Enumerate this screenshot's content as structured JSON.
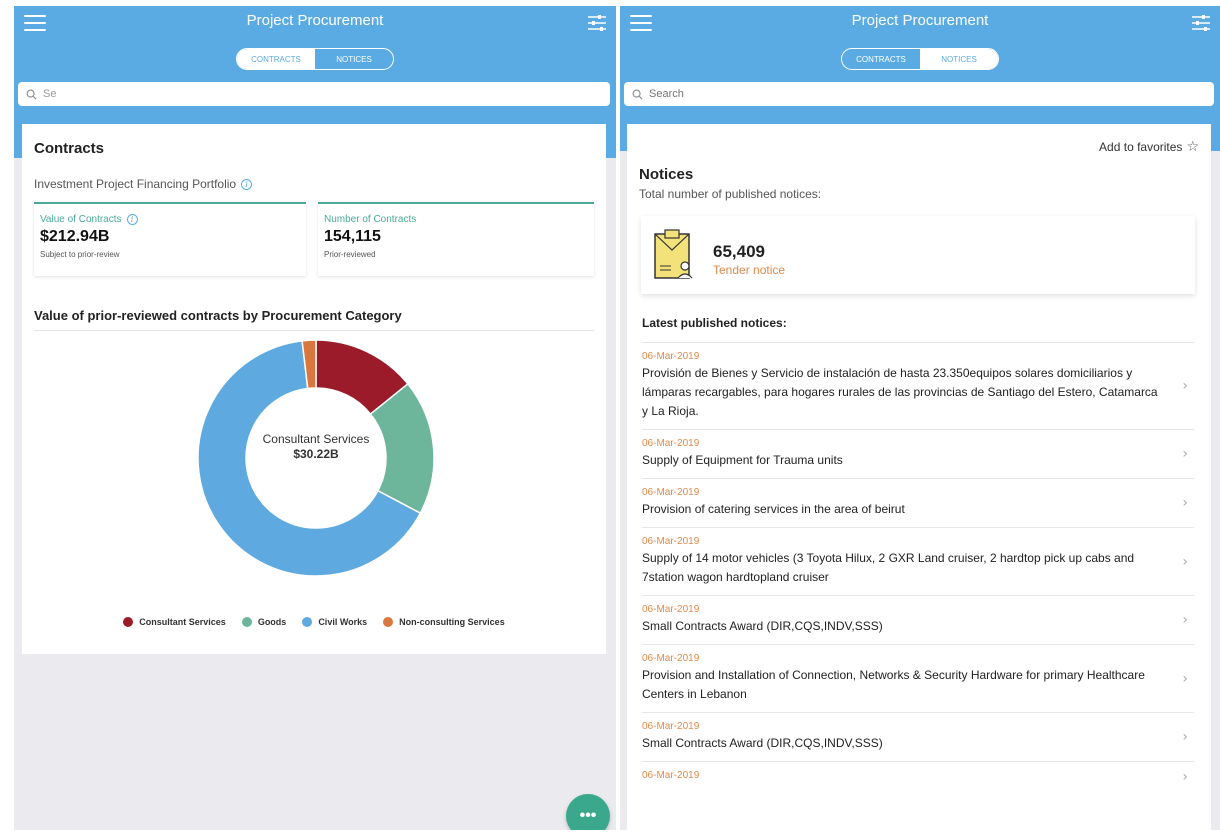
{
  "app_title": "Project Procurement",
  "tabs": {
    "contracts": "CONTRACTS",
    "notices": "NOTICES"
  },
  "left": {
    "search_placeholder": "Search",
    "search_value": "Se",
    "contracts_heading": "Contracts",
    "portfolio": "Investment Project Financing Portfolio",
    "kpis": [
      {
        "label": "Value of Contracts",
        "value": "$212.94B",
        "sub": "Subject to prior-review"
      },
      {
        "label": "Number of Contracts",
        "value": "154,115",
        "sub": "Prior-reviewed"
      }
    ],
    "chart_title": "Value of prior-reviewed contracts by Procurement Category",
    "center_label": {
      "name": "Consultant Services",
      "value": "$30.22B"
    },
    "fab_label": "•••"
  },
  "chart_data": {
    "type": "pie",
    "title": "Value of prior-reviewed contracts by Procurement Category",
    "categories": [
      "Consultant Services",
      "Goods",
      "Civil Works",
      "Non-consulting Services"
    ],
    "values": [
      30.22,
      39.5,
      139.2,
      4.0
    ],
    "colors": [
      "#9b1b2a",
      "#6db59b",
      "#5eaae0",
      "#d9773f"
    ],
    "donut": true,
    "legend": "bottom"
  },
  "right": {
    "search_placeholder": "Search",
    "favorites": "Add to favorites",
    "notices_heading": "Notices",
    "total_label": "Total number of published notices:",
    "tender_count": "65,409",
    "tender_label": "Tender notice",
    "latest_heading": "Latest published notices:",
    "notices": [
      {
        "date": "06-Mar-2019",
        "title": "Provisión de Bienes y Servicio de instalación de hasta 23.350equipos solares domiciliarios y lámparas recargables, para hogares rurales de las provincias de Santiago del Estero, Catamarca y La Rioja."
      },
      {
        "date": "06-Mar-2019",
        "title": "Supply of Equipment for Trauma units"
      },
      {
        "date": "06-Mar-2019",
        "title": "Provision of catering services in the area of beirut"
      },
      {
        "date": "06-Mar-2019",
        "title": "Supply of 14 motor vehicles (3 Toyota Hilux, 2 GXR Land cruiser, 2 hardtop pick up cabs and 7station wagon hardtopland cruiser"
      },
      {
        "date": "06-Mar-2019",
        "title": "Small Contracts Award (DIR,CQS,INDV,SSS)"
      },
      {
        "date": "06-Mar-2019",
        "title": "Provision and Installation of Connection, Networks & Security Hardware for primary Healthcare Centers in Lebanon"
      },
      {
        "date": "06-Mar-2019",
        "title": "Small Contracts Award (DIR,CQS,INDV,SSS)"
      },
      {
        "date": "06-Mar-2019",
        "title": ""
      }
    ]
  },
  "icons": {
    "menu": "hamburger-icon",
    "filter": "sliders-icon",
    "search": "search-icon",
    "info": "info-icon",
    "star": "star-outline-icon",
    "chevron": "chevron-right-icon",
    "tender": "tender-document-icon",
    "more": "more-horizontal-icon"
  },
  "colors": {
    "primary": "#5aabe4",
    "accent_green": "#4aaa98",
    "accent_orange": "#e08a4a",
    "fab": "#3aa88c"
  }
}
